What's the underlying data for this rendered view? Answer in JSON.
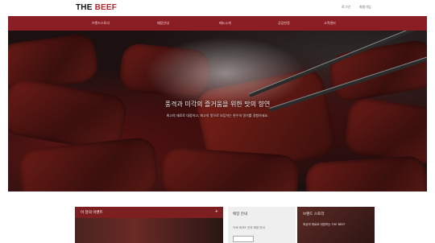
{
  "header": {
    "logo": {
      "part1": "THE ",
      "part2": "BEEF"
    },
    "util_links": [
      "로그인",
      "회원가입"
    ]
  },
  "nav": {
    "items": [
      "브랜드스토리",
      "매장안내",
      "메뉴소개",
      "공감한정",
      "고객센터"
    ]
  },
  "hero": {
    "headline": "풍격과 미각의 즐거움을 위한 맛의 향연",
    "subtext": "최고의 재료로 대접하고, 최고의 맛으로 보답하는 한우의 명가를 경험하세요.",
    "slides": 4,
    "active_slide": 1
  },
  "cards": {
    "event": {
      "title": "이 달의 이벤트",
      "more": "+"
    },
    "store": {
      "title": "매장 안내",
      "desc": "THE BEEF 전국 매장 안내"
    },
    "story": {
      "title": "브랜드 스토리",
      "desc": "최상의 재료로 대접하는 THE BEEF"
    }
  },
  "colors": {
    "brand": "#8b1e25",
    "accent": "#b3262a"
  }
}
